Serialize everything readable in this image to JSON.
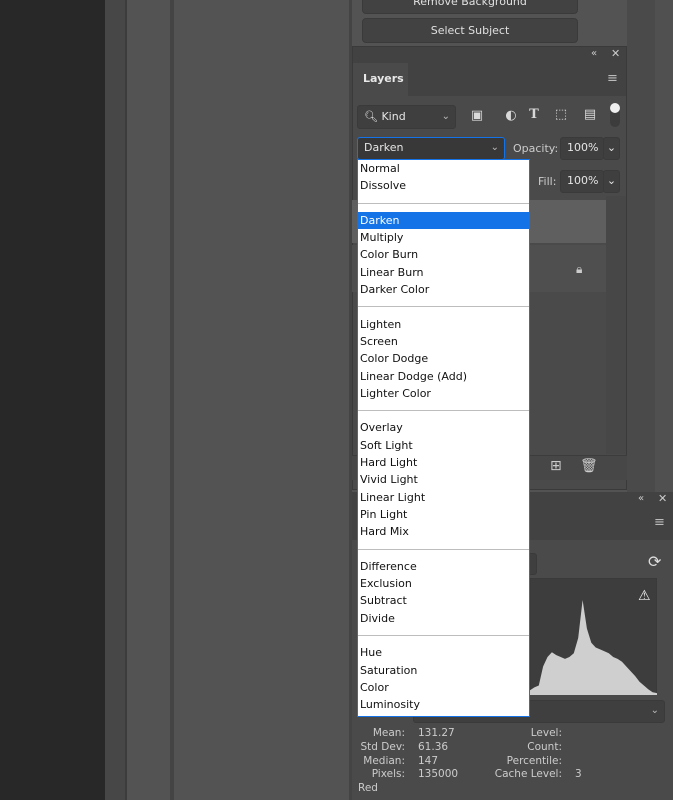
{
  "top_buttons": {
    "remove_background": "Remove Background",
    "select_subject": "Select Subject"
  },
  "layers": {
    "tab": "Layers",
    "filter": {
      "kind": "Kind",
      "icons": [
        "image-filter-icon",
        "adjustment-filter-icon",
        "type-filter-icon",
        "shape-filter-icon",
        "smart-object-filter-icon",
        "filter-toggle"
      ]
    },
    "blend_mode": "Darken",
    "opacity_label": "Opacity:",
    "opacity": "100%",
    "fill_label": "Fill:",
    "fill": "100%"
  },
  "blend_menu": {
    "selected": "Darken",
    "groups": [
      [
        "Normal",
        "Dissolve"
      ],
      [
        "Darken",
        "Multiply",
        "Color Burn",
        "Linear Burn",
        "Darker Color"
      ],
      [
        "Lighten",
        "Screen",
        "Color Dodge",
        "Linear Dodge (Add)",
        "Lighter Color"
      ],
      [
        "Overlay",
        "Soft Light",
        "Hard Light",
        "Vivid Light",
        "Linear Light",
        "Pin Light",
        "Hard Mix"
      ],
      [
        "Difference",
        "Exclusion",
        "Subtract",
        "Divide"
      ],
      [
        "Hue",
        "Saturation",
        "Color",
        "Luminosity"
      ]
    ]
  },
  "histogram": {
    "stats": {
      "mean_label": "Mean:",
      "mean": "131.27",
      "std_label": "Std Dev:",
      "std": "61.36",
      "median_label": "Median:",
      "median": "147",
      "pixels_label": "Pixels:",
      "pixels": "135000",
      "level_label": "Level:",
      "count_label": "Count:",
      "percentile_label": "Percentile:",
      "cache_label": "Cache Level:",
      "cache": "3"
    },
    "channel_label": "Red"
  },
  "colors": {
    "accent": "#1473e6",
    "panel": "#535353",
    "dark": "#282828"
  }
}
